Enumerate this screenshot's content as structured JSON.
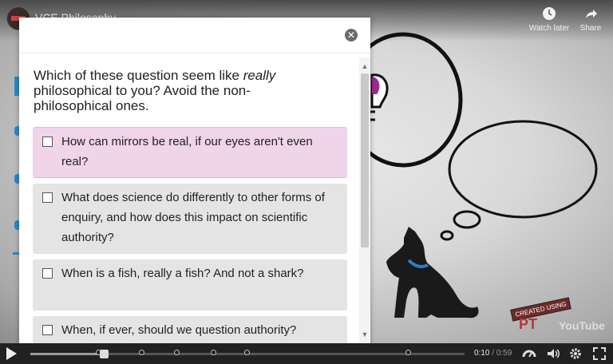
{
  "video": {
    "channel_title": "VCE Philosophy",
    "top_actions": [
      {
        "label": "Watch later",
        "icon": "clock-icon"
      },
      {
        "label": "Share",
        "icon": "share-arrow-icon"
      }
    ],
    "watermark": {
      "band": "CREATED USING",
      "logo": "PT",
      "youtube": "YouTube"
    }
  },
  "quiz": {
    "question_prefix": "Which of these question seem like ",
    "question_emphasis": "really",
    "question_suffix": " philosophical to you? Avoid the non-philosophical ones.",
    "options": [
      {
        "label": "How can mirrors be real, if our eyes aren't even real?",
        "checked": false,
        "highlighted": true
      },
      {
        "label": "What does science do differently to other forms of enquiry, and how does this impact on scientific authority?",
        "checked": false,
        "highlighted": false
      },
      {
        "label": "When is a fish, really a fish? And not a shark?",
        "checked": false,
        "highlighted": false
      },
      {
        "label": "When, if ever, should we question authority?",
        "checked": false,
        "highlighted": false
      }
    ]
  },
  "player": {
    "current_time": "0:10",
    "separator": " / ",
    "duration": "0:59",
    "progress_fraction": 0.17,
    "colors": {
      "highlight": "#f0d4ea",
      "accent_blue": "#2a8ac8",
      "collar": "#2a7fc0"
    }
  }
}
